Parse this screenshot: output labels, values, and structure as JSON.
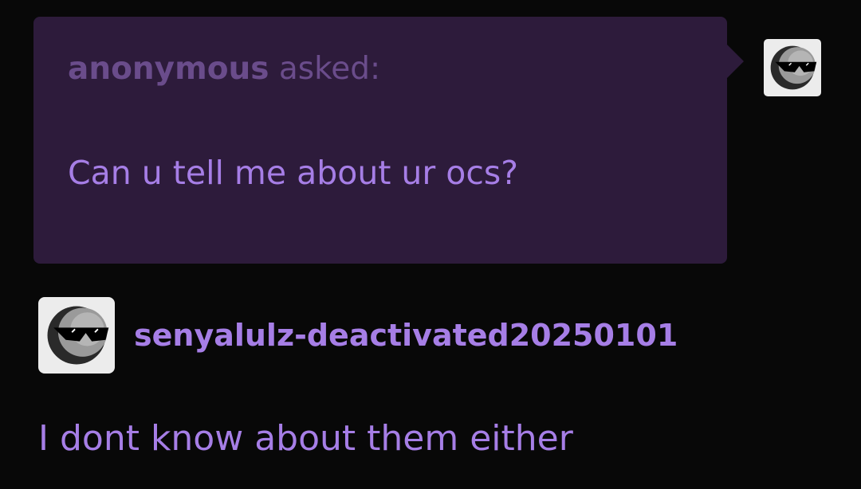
{
  "ask": {
    "asker_name": "anonymous",
    "asked_label": " asked:",
    "question": "Can u tell me about ur ocs?",
    "avatar_icon": "moon-sunglasses-icon"
  },
  "answer": {
    "author_name": "senyalulz-deactivated20250101",
    "avatar_icon": "moon-sunglasses-icon",
    "body": "I dont know about them either"
  },
  "colors": {
    "background": "#080808",
    "bubble": "#2d1b3b",
    "muted_purple": "#6a4c8b",
    "accent_purple": "#a67ee6"
  }
}
